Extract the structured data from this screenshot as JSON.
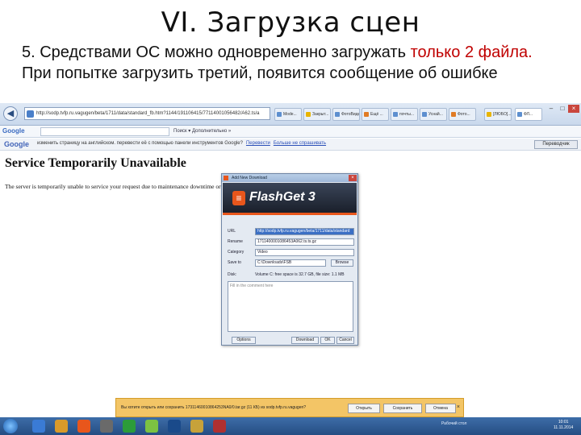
{
  "slide": {
    "title": "VI. Загрузка сцен",
    "text_part1": "5. Средствами ОС можно одновременно загружать ",
    "text_red": "только 2 файла.",
    "text_part2": " При попытке загрузить третий, появится сообщение об ошибке"
  },
  "browser": {
    "address": "http://sodp.tvfp.ru.vagugen/beta/1711/data/standard_fb.htm?1144/191106415/77114001056482/A62.ts/a",
    "search_label": "Google",
    "tabs": [
      "Mode...",
      "Закрыт...",
      "ФотоВиде...",
      "Ещё ...",
      "почты...",
      "Уснай...",
      "Фото...",
      "[ЛЮБО]...",
      "ФЛ..."
    ],
    "gbar_text": "Поиск  ▾  Дополнительно »",
    "translate_text": "изменить страницу на английском. перевести её с помощью панели инструментов Google?",
    "translate_link1": "Перевести",
    "translate_link2": "Больше не спрашивать",
    "translate_button": "Переводчик"
  },
  "error": {
    "heading": "Service Temporarily Unavailable",
    "message": "The server is temporarily unable to service your request due to maintenance downtime or capacity problems. Please try again later."
  },
  "dialog": {
    "title": "Add New Download",
    "brand": "FlashGet 3",
    "url_label": "URL",
    "url_value": "http://sodp.tvfp.ru.vagugen/beta/1711/data/standard",
    "name_label": "Rename",
    "name_value": "1711400001086453A062.ts.ts.gz",
    "category_label": "Category",
    "category_value": "Video",
    "save_label": "Save to",
    "save_value": "C:\\Downloads\\FSB",
    "browse_button": "Browse",
    "disk_label": "Disk:",
    "disk_value": "Volume C: free space is 32.7 GB, file size: 1.1 MB",
    "comment_placeholder": "Fill in the comment here",
    "more_button": "Options",
    "download_button": "Download",
    "ok_button": "OK",
    "cancel_button": "Cancel"
  },
  "notification": {
    "text": "Вы хотите открыть или сохранить 17311460010864253NA0/0.tar.gz (11 КБ) из sodp.tvfp.ru.vagugen?",
    "open": "Открыть",
    "save": "Сохранить",
    "cancel": "Отмена",
    "close": "×"
  },
  "taskbar": {
    "tray": "Рабочий стол",
    "time": "10:01",
    "date": "11.11.2014"
  }
}
